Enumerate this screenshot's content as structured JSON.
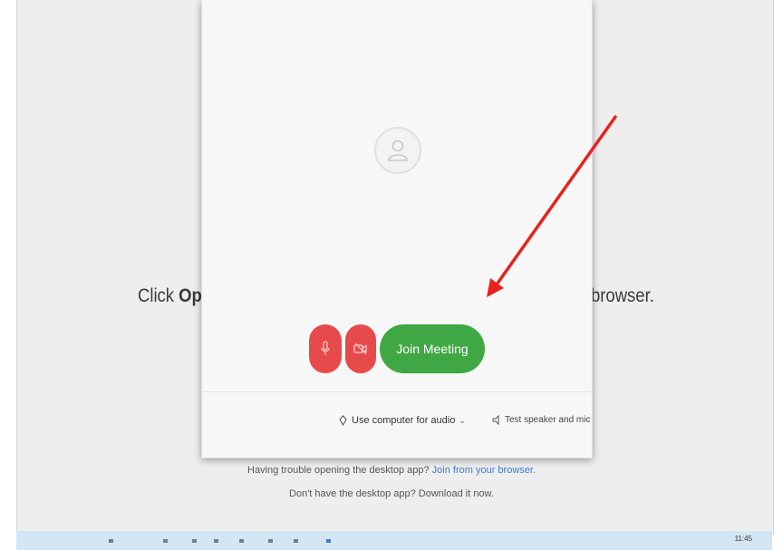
{
  "background": {
    "instruction_prefix": "Click ",
    "instruction_bold": "Ope",
    "instruction_suffix": "browser."
  },
  "dialog": {
    "avatar_icon": "user-avatar-icon",
    "mute_button_icon": "microphone-icon",
    "video_button_icon": "video-icon",
    "join_label": "Join Meeting",
    "audio_option_label": "Use computer for audio",
    "audio_option_icon": "audio-icon",
    "test_option_label": "Test speaker and mic",
    "colors": {
      "join": "#3fa845",
      "mute": "#e74a4a"
    }
  },
  "help": {
    "line1_text": "Having trouble opening the desktop app?",
    "line1_link": "Join from your browser.",
    "line2_text": "Don't have the desktop app? Download it now."
  },
  "annotation": {
    "arrow_color": "#e8211d"
  },
  "taskbar": {
    "clock": "11:45"
  }
}
